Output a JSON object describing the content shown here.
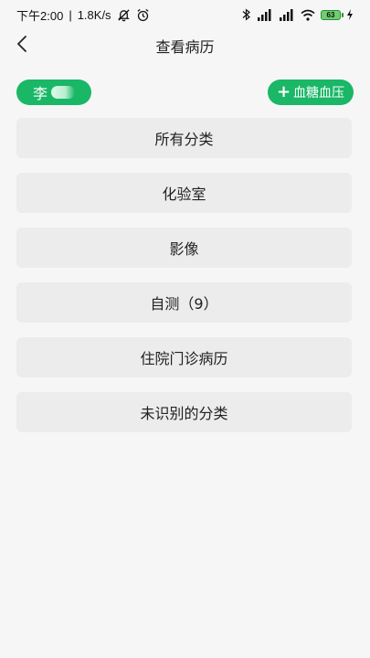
{
  "status_bar": {
    "time": "下午2:00",
    "separator": "|",
    "speed": "1.8K/s",
    "battery_level": "63",
    "accent": "#19b766"
  },
  "header": {
    "title": "查看病历",
    "back_icon": "chevron-left-icon"
  },
  "patient": {
    "name": "李",
    "name_masked": true
  },
  "actions": {
    "add_label": "血糖血压",
    "add_icon": "plus-icon"
  },
  "categories": [
    {
      "label": "所有分类"
    },
    {
      "label": "化验室"
    },
    {
      "label": "影像"
    },
    {
      "label": "自测（9）"
    },
    {
      "label": "住院门诊病历"
    },
    {
      "label": "未识别的分类"
    }
  ],
  "colors": {
    "accent": "#19b766",
    "background": "#f6f6f6",
    "card": "#ececec"
  }
}
